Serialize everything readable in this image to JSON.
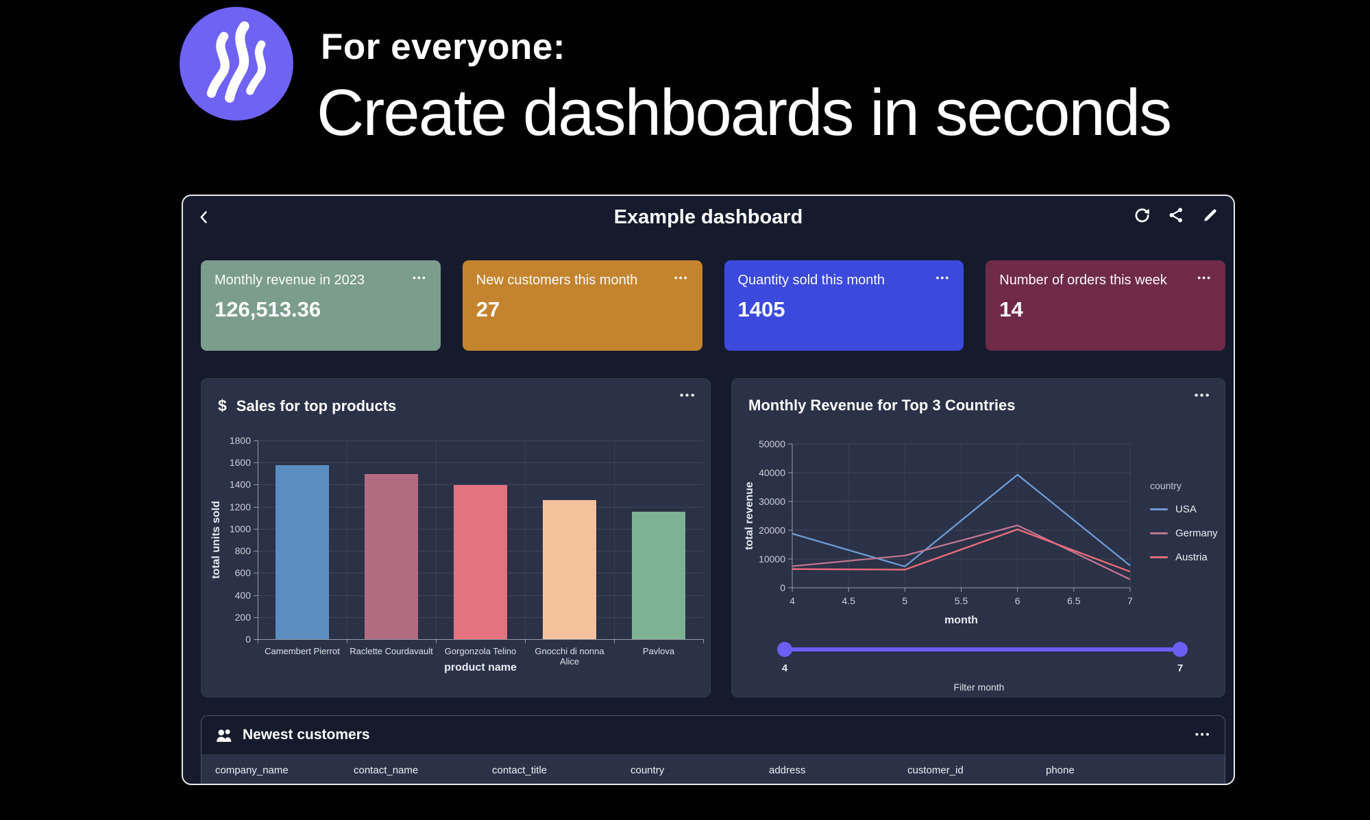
{
  "hero": {
    "kicker": "For everyone:",
    "title": "Create dashboards in seconds",
    "logo_color": "#6F63F4"
  },
  "window": {
    "title": "Example dashboard"
  },
  "menu_dots": "•••",
  "cards": [
    {
      "title": "Monthly revenue in 2023",
      "value": "126,513.36",
      "color": "#7C9D8B"
    },
    {
      "title": "New customers this month",
      "value": "27",
      "color": "#C4842F"
    },
    {
      "title": "Quantity sold this month",
      "value": "1405",
      "color": "#3B4ADC"
    },
    {
      "title": "Number of orders this week",
      "value": "14",
      "color": "#6F2A4A"
    }
  ],
  "chart_data": [
    {
      "type": "bar",
      "title": "Sales for top products",
      "title_icon": "$",
      "categories": [
        "Camembert Pierrot",
        "Raclette Courdavault",
        "Gorgonzola Telino",
        "Gnocchi di nonna Alice",
        "Pavlova"
      ],
      "values": [
        1575,
        1498,
        1395,
        1260,
        1155
      ],
      "bar_colors": [
        "#5C8DC0",
        "#B26C81",
        "#E4737F",
        "#F3C29C",
        "#7DB394"
      ],
      "xlabel": "product name",
      "ylabel": "total units sold",
      "ylim": [
        0,
        1800
      ],
      "ytick_step": 200,
      "grid": true
    },
    {
      "type": "line",
      "title": "Monthly Revenue for Top 3 Countries",
      "x": [
        4,
        5,
        6,
        7
      ],
      "series": [
        {
          "name": "USA",
          "color": "#6D9CD6",
          "values": [
            18800,
            7400,
            39300,
            7700
          ]
        },
        {
          "name": "Germany",
          "color": "#C07590",
          "values": [
            7500,
            11200,
            21700,
            2900
          ]
        },
        {
          "name": "Austria",
          "color": "#EE6E7B",
          "values": [
            6500,
            6300,
            20300,
            5600
          ]
        }
      ],
      "xlabel": "month",
      "ylabel": "total revenue",
      "xlim": [
        4,
        7
      ],
      "xtick_step": 0.5,
      "ylim": [
        0,
        50000
      ],
      "ytick_step": 10000,
      "legend_title": "country",
      "legend_position": "right",
      "grid": true
    }
  ],
  "slider": {
    "label": "Filter month",
    "min": "4",
    "max": "7",
    "color": "#6A5FF2"
  },
  "table": {
    "title": "Newest customers",
    "columns": [
      "company_name",
      "contact_name",
      "contact_title",
      "country",
      "address",
      "customer_id",
      "phone"
    ]
  }
}
